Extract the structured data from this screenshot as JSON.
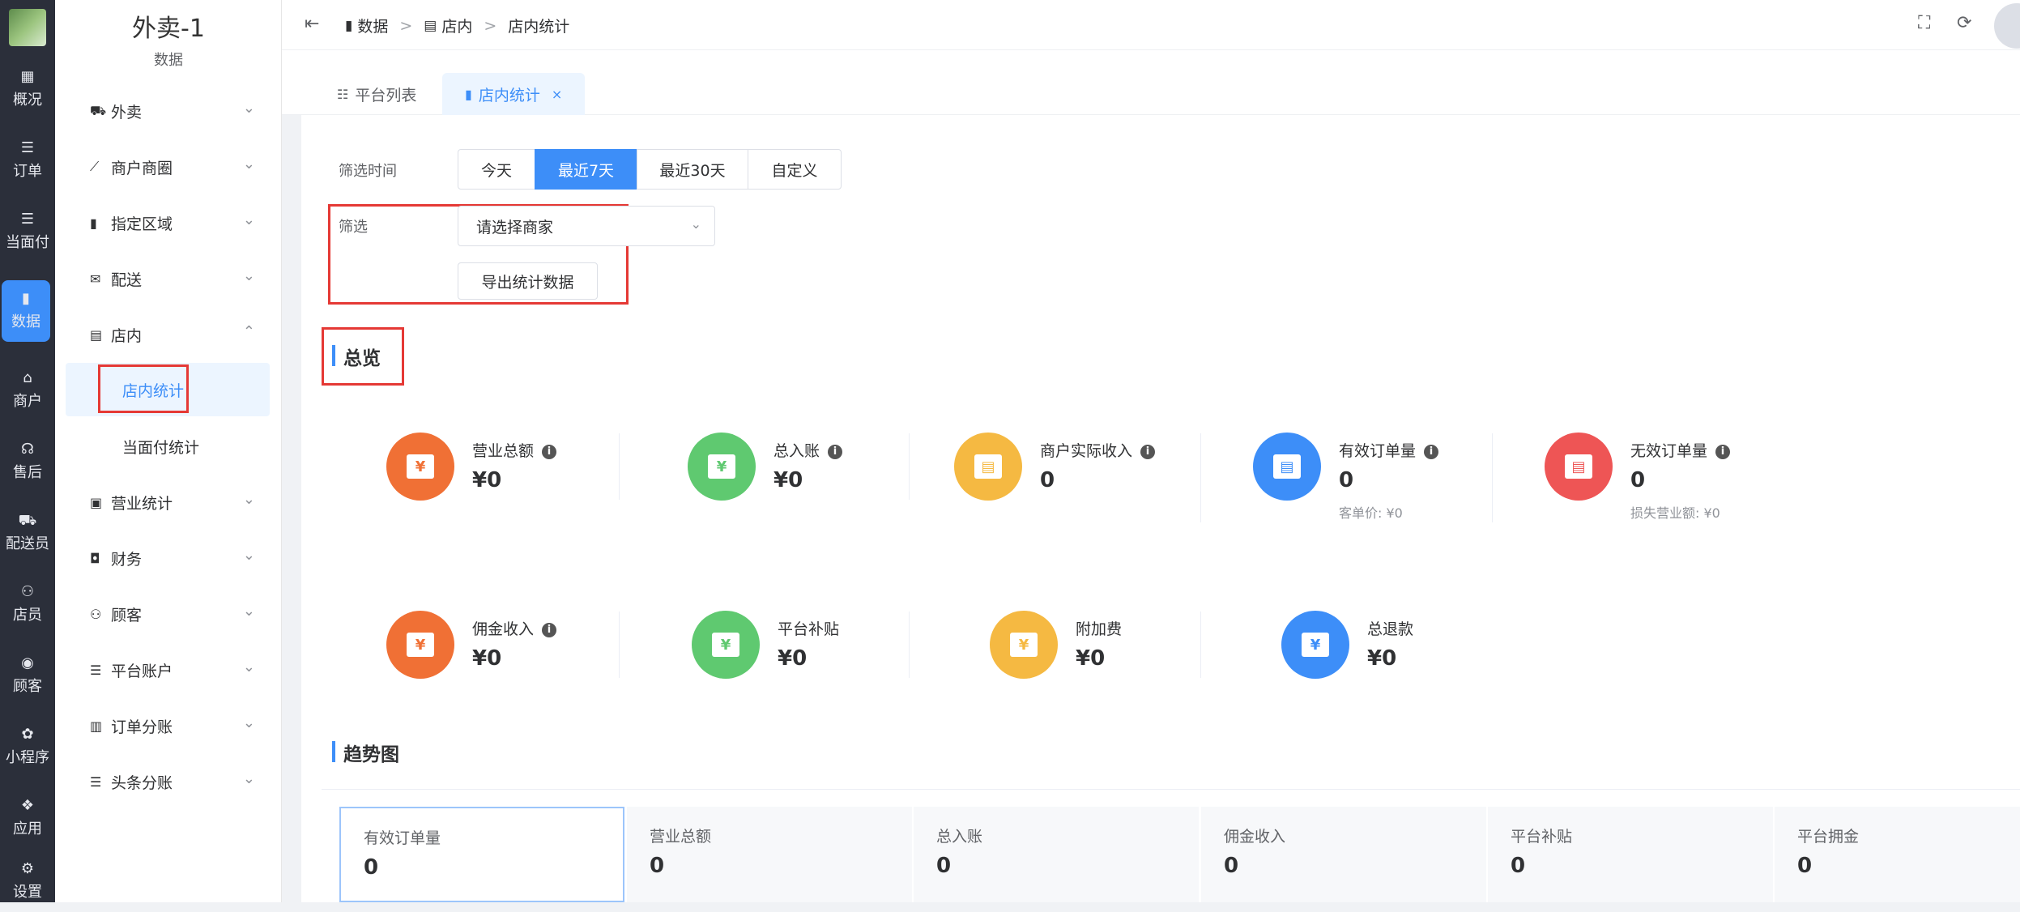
{
  "rail": {
    "items": [
      {
        "icon": "▦",
        "label": "概况"
      },
      {
        "icon": "☰",
        "label": "订单"
      },
      {
        "icon": "☰",
        "label": "当面付"
      },
      {
        "icon": "▮",
        "label": "数据"
      },
      {
        "icon": "⌂",
        "label": "商户"
      },
      {
        "icon": "☊",
        "label": "售后"
      },
      {
        "icon": "⛟",
        "label": "配送员"
      },
      {
        "icon": "⚇",
        "label": "店员"
      },
      {
        "icon": "◉",
        "label": "顾客"
      },
      {
        "icon": "✿",
        "label": "小程序"
      },
      {
        "icon": "❖",
        "label": "应用"
      },
      {
        "icon": "⚙",
        "label": "设置"
      }
    ],
    "active_index": 3
  },
  "sidebar": {
    "title": "外卖-1",
    "subtitle": "数据",
    "items": [
      {
        "icon": "⛟",
        "label": "外卖",
        "chevron": "⌄"
      },
      {
        "icon": "⟋",
        "label": "商户商圈",
        "chevron": "⌄"
      },
      {
        "icon": "▮",
        "label": "指定区域",
        "chevron": "⌄"
      },
      {
        "icon": "✉",
        "label": "配送",
        "chevron": "⌄"
      },
      {
        "icon": "▤",
        "label": "店内",
        "chevron": "⌃"
      },
      {
        "icon": "▣",
        "label": "营业统计",
        "chevron": "⌄"
      },
      {
        "icon": "◘",
        "label": "财务",
        "chevron": "⌄"
      },
      {
        "icon": "⚇",
        "label": "顾客",
        "chevron": "⌄"
      },
      {
        "icon": "☰",
        "label": "平台账户",
        "chevron": "⌄"
      },
      {
        "icon": "▥",
        "label": "订单分账",
        "chevron": "⌄"
      },
      {
        "icon": "☰",
        "label": "头条分账",
        "chevron": "⌄"
      }
    ],
    "children": [
      {
        "label": "店内统计",
        "active": true
      },
      {
        "label": "当面付统计",
        "active": false
      }
    ]
  },
  "topbar": {
    "fold_icon": "⇤",
    "breadcrumbs": [
      {
        "icon": "▮",
        "label": "数据"
      },
      {
        "icon": "▤",
        "label": "店内"
      },
      {
        "icon": "",
        "label": "店内统计"
      }
    ],
    "separator": ">",
    "fullscreen_icon": "⛶",
    "refresh_icon": "⟳"
  },
  "tabs": [
    {
      "icon": "☷",
      "label": "平台列表",
      "active": false
    },
    {
      "icon": "▮",
      "label": "店内统计",
      "active": true,
      "close": "×"
    }
  ],
  "filter": {
    "time_label": "筛选时间",
    "time_options": [
      "今天",
      "最近7天",
      "最近30天",
      "自定义"
    ],
    "time_selected": "最近7天",
    "filter_label": "筛选",
    "merchant_placeholder": "请选择商家",
    "export_label": "导出统计数据"
  },
  "overview": {
    "title": "总览",
    "stats_row1": [
      {
        "title": "营业总额",
        "value": "¥0",
        "info": true,
        "color": "#f07035",
        "symbol": "¥",
        "sub": ""
      },
      {
        "title": "总入账",
        "value": "¥0",
        "info": true,
        "color": "#5fc970",
        "symbol": "¥",
        "sub": ""
      },
      {
        "title": "商户实际收入",
        "value": "0",
        "info": true,
        "color": "#f5b942",
        "symbol": "▤",
        "sub": ""
      },
      {
        "title": "有效订单量",
        "value": "0",
        "info": true,
        "color": "#3d8ef8",
        "symbol": "▤",
        "sub": "客单价: ¥0"
      },
      {
        "title": "无效订单量",
        "value": "0",
        "info": true,
        "color": "#ee5555",
        "symbol": "▤",
        "sub": "损失营业额: ¥0"
      }
    ],
    "stats_row2": [
      {
        "title": "佣金收入",
        "value": "¥0",
        "info": true,
        "color": "#f07035",
        "symbol": "¥"
      },
      {
        "title": "平台补贴",
        "value": "¥0",
        "info": false,
        "color": "#5fc970",
        "symbol": "¥"
      },
      {
        "title": "附加费",
        "value": "¥0",
        "info": false,
        "color": "#f5b942",
        "symbol": "¥"
      },
      {
        "title": "总退款",
        "value": "¥0",
        "info": false,
        "color": "#3d8ef8",
        "symbol": "¥"
      }
    ],
    "info_icon": "i"
  },
  "trend": {
    "title": "趋势图",
    "cards": [
      {
        "label": "有效订单量",
        "value": "0",
        "active": true
      },
      {
        "label": "营业总额",
        "value": "0",
        "active": false
      },
      {
        "label": "总入账",
        "value": "0",
        "active": false
      },
      {
        "label": "佣金收入",
        "value": "0",
        "active": false
      },
      {
        "label": "平台补贴",
        "value": "0",
        "active": false
      },
      {
        "label": "平台拥金",
        "value": "0",
        "active": false
      }
    ]
  }
}
